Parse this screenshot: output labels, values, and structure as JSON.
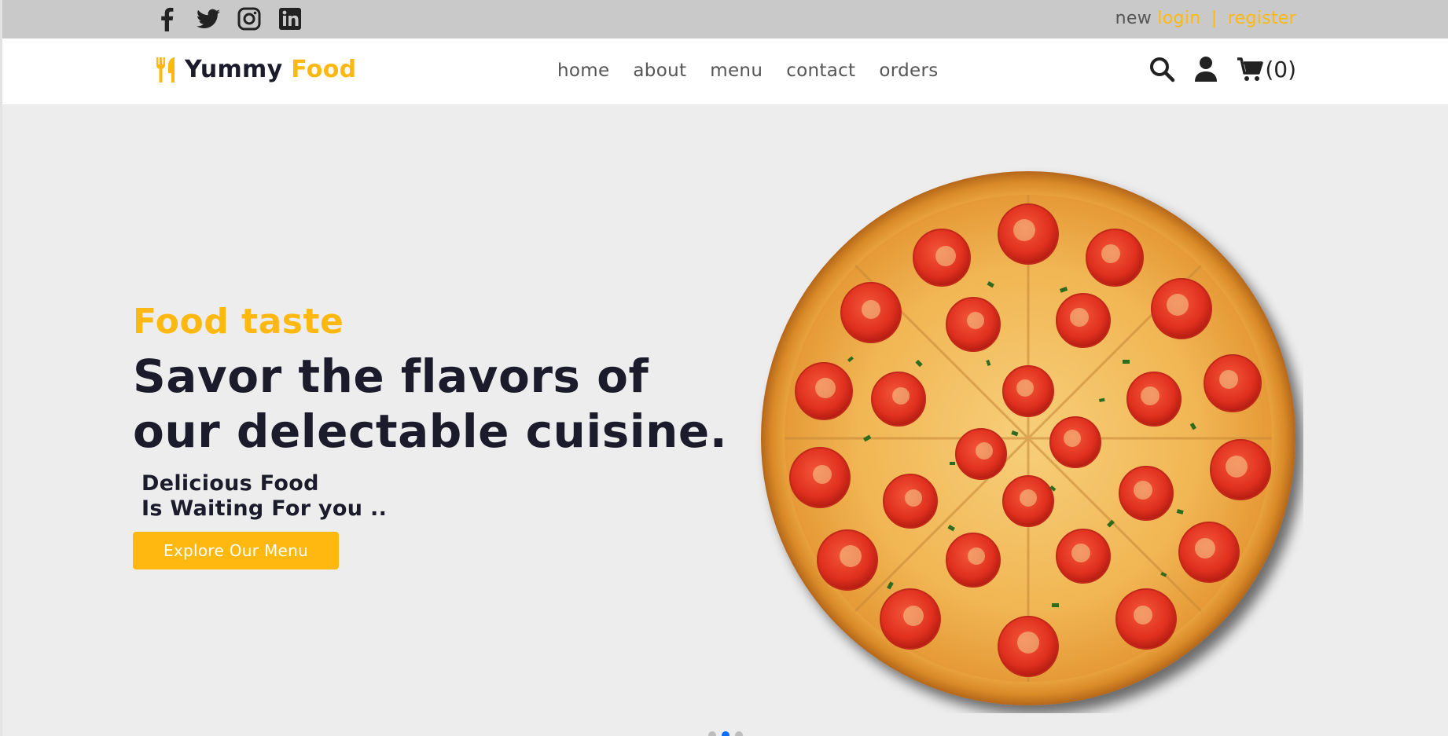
{
  "topbar": {
    "social": [
      {
        "name": "facebook-icon"
      },
      {
        "name": "twitter-icon"
      },
      {
        "name": "instagram-icon"
      },
      {
        "name": "linkedin-icon"
      }
    ],
    "auth": {
      "prefix": "new",
      "login": "login",
      "separator": "|",
      "register": "register"
    }
  },
  "header": {
    "brand": {
      "word1": "Yummy",
      "word2": "Food",
      "icon": "utensils-icon"
    },
    "nav": [
      "home",
      "about",
      "menu",
      "contact",
      "orders"
    ],
    "tools": {
      "search_icon": "search-icon",
      "user_icon": "user-icon",
      "cart_icon": "cart-icon",
      "cart_count": "(0)"
    }
  },
  "hero": {
    "kicker": "Food taste",
    "headline_line1": "Savor the flavors of",
    "headline_line2": "our delectable cuisine.",
    "tagline_line1": "Delicious Food",
    "tagline_line2": "Is Waiting For you ..",
    "cta": "Explore Our Menu",
    "image": "pizza",
    "carousel": {
      "slides": 3,
      "active_index": 1
    }
  },
  "colors": {
    "accent": "#ffb80f",
    "dark": "#1b1b2b",
    "topbar_bg": "#c9c9ca",
    "hero_bg": "#ededed",
    "active_dot": "#0d6efd"
  }
}
